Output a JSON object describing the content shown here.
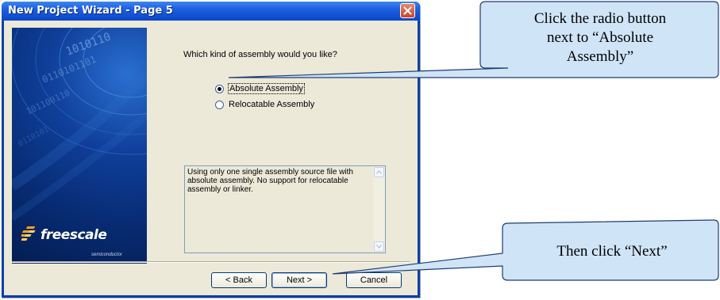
{
  "dialog": {
    "title": "New Project Wizard - Page  5",
    "question": "Which kind of assembly would you like?",
    "options": [
      {
        "label": "Absolute Assembly",
        "selected": true
      },
      {
        "label": "Relocatable Assembly",
        "selected": false
      }
    ],
    "description": "Using only one single assembly source file with absolute assembly. No support for relocatable assembly or linker.",
    "buttons": {
      "back": "< Back",
      "next": "Next >",
      "cancel": "Cancel"
    },
    "banner": {
      "logo_text": "freescale",
      "logo_subtext": "semiconductor"
    }
  },
  "callouts": {
    "top_line1": "Click the radio button",
    "top_line2": "next to “Absolute",
    "top_line3": "Assembly”",
    "bottom": "Then click “Next”"
  },
  "colors": {
    "callout_fill": "#cfe4f7",
    "callout_stroke": "#1f3b73",
    "titlebar": "#0a47c8"
  }
}
